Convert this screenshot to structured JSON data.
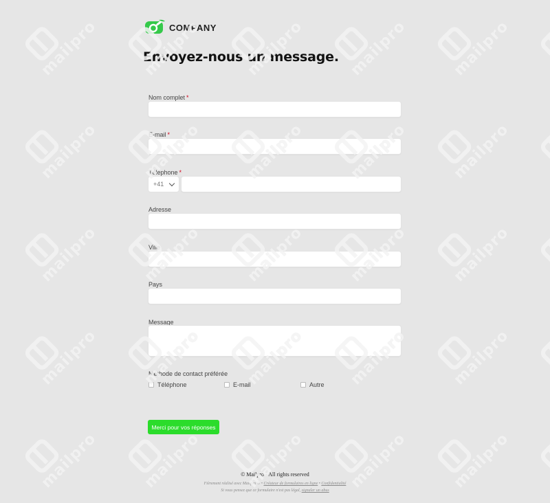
{
  "brand": {
    "name": "COMPANY",
    "colors": {
      "logo": "#35c94a",
      "submit": "#2bdc2b",
      "required": "#d0021b"
    }
  },
  "watermark": {
    "text": "mailpro"
  },
  "page": {
    "title": "Envoyez-nous un message."
  },
  "form": {
    "required_marker": "*",
    "fields": {
      "full_name": {
        "label": "Nom complet",
        "value": ""
      },
      "email": {
        "label": "E-mail",
        "value": ""
      },
      "phone": {
        "label": "Téléphone",
        "country_code": "+41",
        "value": ""
      },
      "address": {
        "label": "Adresse",
        "value": ""
      },
      "city": {
        "label": "Ville",
        "value": ""
      },
      "country": {
        "label": "Pays",
        "value": ""
      },
      "message": {
        "label": "Message",
        "value": ""
      }
    },
    "contact_method": {
      "label": "Méthode de contact préférée",
      "options": [
        "Téléphone",
        "E-mail",
        "Autre"
      ]
    },
    "submit_label": "Merci pour vos réponses"
  },
  "footer": {
    "copyright": "© Mailpro - All rights reserved",
    "made_with": "Fièrement réalisé avec Mailpro ®",
    "sep": "•",
    "form_builder_link": "Créateur de formulaires en ligne",
    "privacy_link": "Confidentialité",
    "abuse_text": "Si vous pensez que ce formulaire n'est pas légal,",
    "abuse_link": "signaler un abus"
  }
}
